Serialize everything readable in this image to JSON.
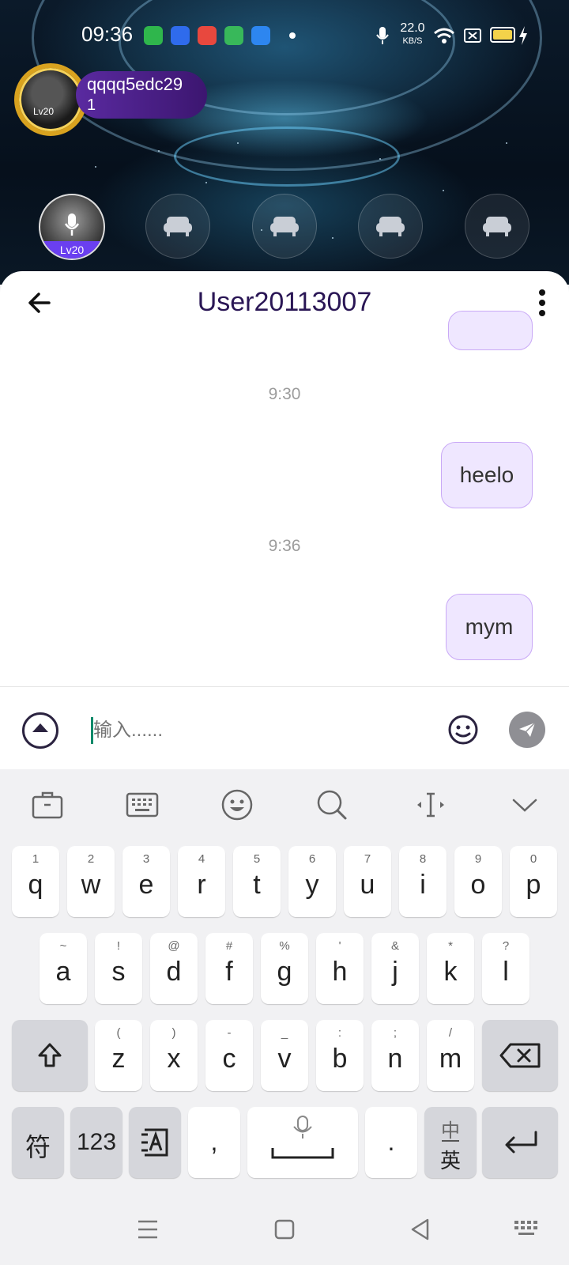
{
  "status_bar": {
    "time": "09:36",
    "net_speed_value": "22.0",
    "net_speed_unit": "KB/S",
    "icons": [
      "shield-app-icon",
      "paw-app-icon",
      "music-app-icon",
      "grid-app-icon",
      "q-app-icon",
      "dot-icon",
      "mic-icon",
      "wifi-icon",
      "sim-icon",
      "battery-icon",
      "charging-icon"
    ]
  },
  "room": {
    "host": {
      "name": "qqqq5edc29",
      "count": "1",
      "level": "Lv20"
    },
    "seats": [
      {
        "level": "Lv20",
        "occupied": true
      },
      {
        "occupied": false
      },
      {
        "occupied": false
      },
      {
        "occupied": false
      },
      {
        "occupied": false
      }
    ]
  },
  "chat": {
    "title": "User20113007",
    "messages": [
      {
        "type": "timestamp",
        "text": "9:30"
      },
      {
        "type": "outgoing",
        "text": "heelo"
      },
      {
        "type": "timestamp",
        "text": "9:36"
      },
      {
        "type": "outgoing",
        "text": "mym"
      }
    ],
    "input_placeholder": "输入......",
    "bubble_color": "#efe7ff",
    "bubble_border": "#c9a9f6",
    "title_color": "#2a1655"
  },
  "keyboard": {
    "toolbar": [
      "briefcase-icon",
      "keyboard-icon",
      "emoji-icon",
      "search-icon",
      "cursor-icon",
      "collapse-icon"
    ],
    "row1": [
      {
        "hint": "1",
        "ch": "q"
      },
      {
        "hint": "2",
        "ch": "w"
      },
      {
        "hint": "3",
        "ch": "e"
      },
      {
        "hint": "4",
        "ch": "r"
      },
      {
        "hint": "5",
        "ch": "t"
      },
      {
        "hint": "6",
        "ch": "y"
      },
      {
        "hint": "7",
        "ch": "u"
      },
      {
        "hint": "8",
        "ch": "i"
      },
      {
        "hint": "9",
        "ch": "o"
      },
      {
        "hint": "0",
        "ch": "p"
      }
    ],
    "row2": [
      {
        "hint": "~",
        "ch": "a"
      },
      {
        "hint": "!",
        "ch": "s"
      },
      {
        "hint": "@",
        "ch": "d"
      },
      {
        "hint": "#",
        "ch": "f"
      },
      {
        "hint": "%",
        "ch": "g"
      },
      {
        "hint": "'",
        "ch": "h"
      },
      {
        "hint": "&",
        "ch": "j"
      },
      {
        "hint": "*",
        "ch": "k"
      },
      {
        "hint": "?",
        "ch": "l"
      }
    ],
    "row3": [
      {
        "hint": "(",
        "ch": "z"
      },
      {
        "hint": ")",
        "ch": "x"
      },
      {
        "hint": "-",
        "ch": "c"
      },
      {
        "hint": "_",
        "ch": "v"
      },
      {
        "hint": ":",
        "ch": "b"
      },
      {
        "hint": ";",
        "ch": "n"
      },
      {
        "hint": "/",
        "ch": "m"
      }
    ],
    "symbols_label": "符",
    "numbers_label": "123",
    "comma_label": ",",
    "period_label": ".",
    "lang_top": "中",
    "lang_bottom": "英"
  },
  "nav_bar": [
    "menu-icon",
    "home-icon",
    "back-icon",
    "keyboard-hide-icon"
  ]
}
